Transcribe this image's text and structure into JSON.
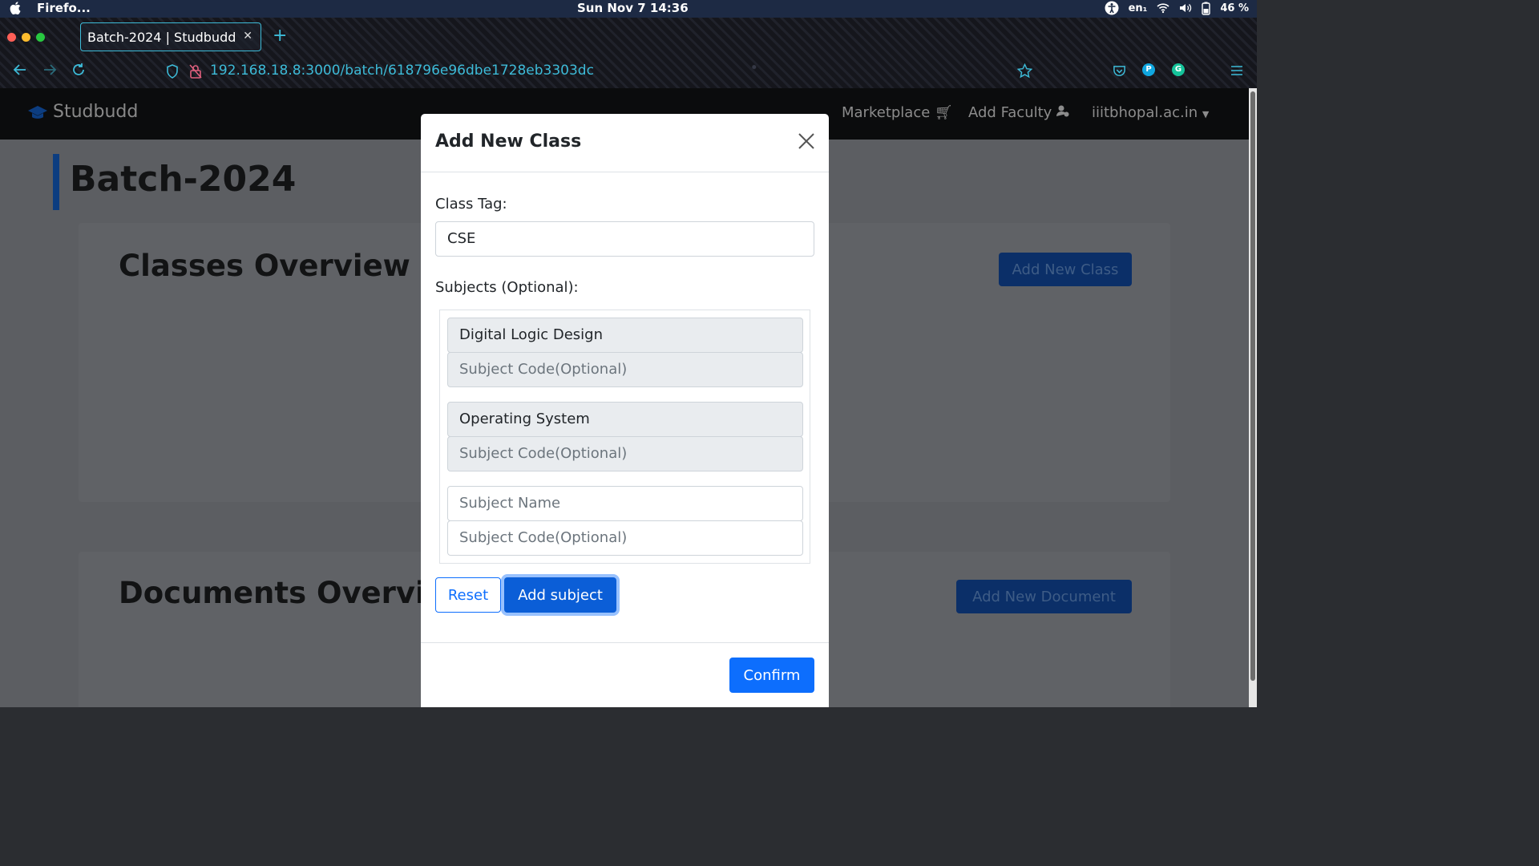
{
  "os_bar": {
    "app_name": "Firefo...",
    "datetime": "Sun Nov 7  14:36",
    "language": "en₁",
    "battery": "46 %"
  },
  "browser": {
    "tab_title": "Batch-2024 | Studbudd",
    "url": "192.168.18.8:3000/batch/618796e96dbe1728eb3303dc",
    "ext_p": "P",
    "ext_g": "G"
  },
  "navbar": {
    "brand": "Studbudd",
    "links": [
      "Marketplace",
      "Add Faculty",
      "iiitbhopal.ac.in"
    ]
  },
  "page": {
    "title": "Batch-2024",
    "classes_title": "Classes Overview",
    "add_class_button": "Add New Class",
    "documents_title": "Documents Overvie",
    "add_document_button": "Add New Document"
  },
  "modal": {
    "title": "Add New Class",
    "class_tag_label": "Class Tag:",
    "class_tag_value": "CSE",
    "subjects_label": "Subjects (Optional):",
    "subjects": [
      {
        "name": "Digital Logic Design",
        "code_placeholder": "Subject Code(Optional)"
      },
      {
        "name": "Operating System",
        "code_placeholder": "Subject Code(Optional)"
      }
    ],
    "new_subject_name_placeholder": "Subject Name",
    "new_subject_code_placeholder": "Subject Code(Optional)",
    "reset_button": "Reset",
    "add_subject_button": "Add subject",
    "confirm_button": "Confirm"
  }
}
